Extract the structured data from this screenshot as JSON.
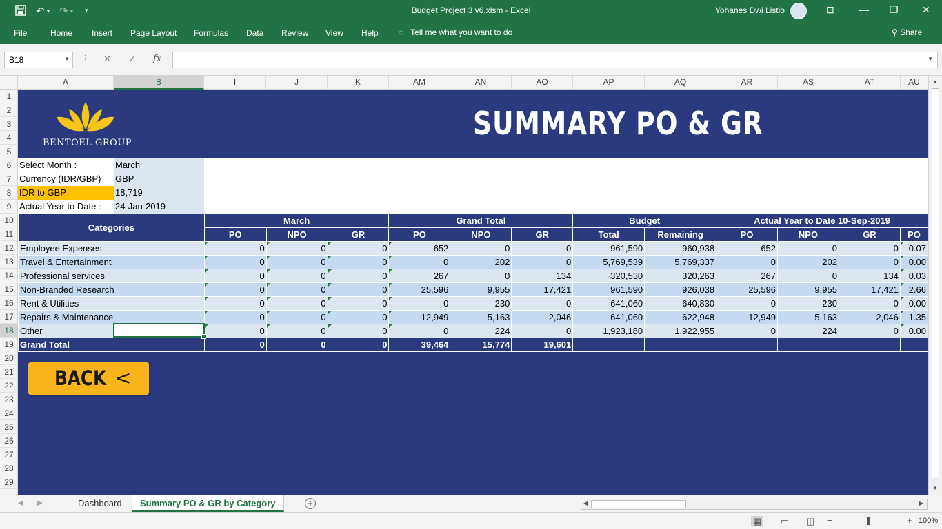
{
  "window": {
    "title": "Budget Project 3 v6.xlsm  -  Excel",
    "user": "Yohanes Dwi Listio"
  },
  "ribbon": {
    "tabs": [
      "File",
      "Home",
      "Insert",
      "Page Layout",
      "Formulas",
      "Data",
      "Review",
      "View",
      "Help"
    ],
    "tell_me": "Tell me what you want to do",
    "share": "Share"
  },
  "formula_bar": {
    "name_box": "B18",
    "fx": "fx",
    "formula": ""
  },
  "columns": [
    "A",
    "B",
    "I",
    "J",
    "K",
    "AM",
    "AN",
    "AO",
    "AP",
    "AQ",
    "AR",
    "AS",
    "AT",
    "AU"
  ],
  "rows": [
    "1",
    "2",
    "3",
    "4",
    "5",
    "6",
    "7",
    "8",
    "9",
    "10",
    "11",
    "12",
    "13",
    "14",
    "15",
    "16",
    "17",
    "18",
    "19",
    "20",
    "21",
    "22",
    "23",
    "24",
    "25",
    "26",
    "27",
    "28",
    "29"
  ],
  "sheet": {
    "brand": "BENTOEL GROUP",
    "title": "SUMMARY PO & GR",
    "params": [
      {
        "label": "Select Month :",
        "value": "March"
      },
      {
        "label": "Currency (IDR/GBP)",
        "value": "GBP"
      },
      {
        "label": "IDR to GBP",
        "value": "18,719"
      },
      {
        "label": "Actual Year to Date :",
        "value": "24-Jan-2019"
      }
    ],
    "group_headers": {
      "categories": "Categories",
      "month": "March",
      "grand_total": "Grand Total",
      "budget": "Budget",
      "ytd": "Actual Year to Date 10-Sep-2019"
    },
    "sub_headers": [
      "PO",
      "NPO",
      "GR",
      "PO",
      "NPO",
      "GR",
      "Total",
      "Remaining",
      "PO",
      "NPO",
      "GR",
      "PO"
    ],
    "rows": [
      {
        "cat": "Employee Expenses",
        "v": [
          "0",
          "0",
          "0",
          "652",
          "0",
          "0",
          "961,590",
          "960,938",
          "652",
          "0",
          "0",
          "0.07"
        ]
      },
      {
        "cat": "Travel & Entertainment",
        "v": [
          "0",
          "0",
          "0",
          "0",
          "202",
          "0",
          "5,769,539",
          "5,769,337",
          "0",
          "202",
          "0",
          "0.00"
        ]
      },
      {
        "cat": "Professional services",
        "v": [
          "0",
          "0",
          "0",
          "267",
          "0",
          "134",
          "320,530",
          "320,263",
          "267",
          "0",
          "134",
          "0.03"
        ]
      },
      {
        "cat": "Non-Branded Research",
        "v": [
          "0",
          "0",
          "0",
          "25,596",
          "9,955",
          "17,421",
          "961,590",
          "926,038",
          "25,596",
          "9,955",
          "17,421",
          "2.66"
        ]
      },
      {
        "cat": "Rent & Utilities",
        "v": [
          "0",
          "0",
          "0",
          "0",
          "230",
          "0",
          "641,060",
          "640,830",
          "0",
          "230",
          "0",
          "0.00"
        ]
      },
      {
        "cat": "Repairs & Maintenance",
        "v": [
          "0",
          "0",
          "0",
          "12,949",
          "5,163",
          "2,046",
          "641,060",
          "622,948",
          "12,949",
          "5,163",
          "2,046",
          "1.35"
        ]
      },
      {
        "cat": "Other",
        "v": [
          "0",
          "0",
          "0",
          "0",
          "224",
          "0",
          "1,923,180",
          "1,922,955",
          "0",
          "224",
          "0",
          "0.00"
        ]
      }
    ],
    "total": {
      "cat": "Grand Total",
      "v": [
        "0",
        "0",
        "0",
        "39,464",
        "15,774",
        "19,601",
        "",
        "",
        "",
        "",
        "",
        ""
      ]
    },
    "back_button": "BACK",
    "back_arrow": "<"
  },
  "sheet_tabs": [
    "Dashboard",
    "Summary PO & GR by Category"
  ],
  "active_tab": "Summary PO & GR by Category",
  "status": {
    "zoom": "100%"
  },
  "colors": {
    "excel_green": "#217346",
    "sheet_navy": "#2b3a7f",
    "back_yellow": "#f9b31b",
    "highlight_orange": "#ffc000"
  }
}
